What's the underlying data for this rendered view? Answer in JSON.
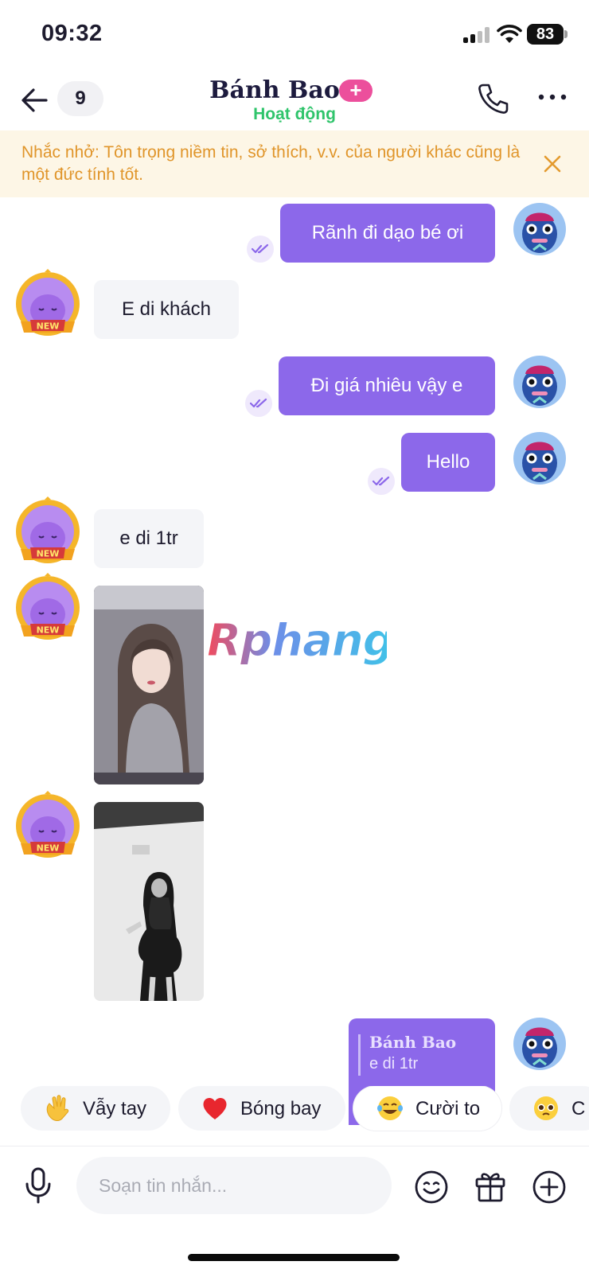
{
  "status_bar": {
    "time": "09:32",
    "battery": "83"
  },
  "header": {
    "unread_count": "9",
    "contact_name": "Bánh Bao",
    "plus_badge": "+",
    "contact_status": "Hoạt động"
  },
  "notice": {
    "text": "Nhắc nhở: Tôn trọng niềm tin, sở thích, v.v. của người khác cũng là một đức tính tốt."
  },
  "messages": [
    {
      "sender": "me",
      "text": "Rãnh đi dạo bé ơi",
      "read": true
    },
    {
      "sender": "contact",
      "text": "E di khách",
      "avatar_badge": "NEW"
    },
    {
      "sender": "me",
      "text": "Đi giá nhiêu vậy e",
      "read": true
    },
    {
      "sender": "me",
      "text": "Hello",
      "read": true
    },
    {
      "sender": "contact",
      "text": "e di 1tr",
      "avatar_badge": "NEW"
    },
    {
      "sender": "contact",
      "type": "photo",
      "avatar_badge": "NEW"
    },
    {
      "sender": "contact",
      "type": "photo",
      "avatar_badge": "NEW"
    },
    {
      "sender": "me",
      "type": "reply",
      "quote_author": "Bánh Bao",
      "quote_text": "e di 1tr"
    }
  ],
  "watermark": "Rphang",
  "quick_reactions": [
    {
      "emoji": "waving-hand",
      "label": "Vẫy tay"
    },
    {
      "emoji": "red-heart",
      "label": "Bóng bay"
    },
    {
      "emoji": "tears-of-joy",
      "label": "Cười to"
    },
    {
      "emoji": "pleading-face",
      "label": "C"
    }
  ],
  "composer": {
    "placeholder": "Soạn tin nhắn..."
  },
  "colors": {
    "outgoing_bubble": "#8c68ea",
    "incoming_bubble": "#f4f5f8",
    "online_status": "#2fc46b",
    "notice_background": "#fdf6e6",
    "notice_text": "#e0952a",
    "plus_badge": "#ec4f9c"
  }
}
